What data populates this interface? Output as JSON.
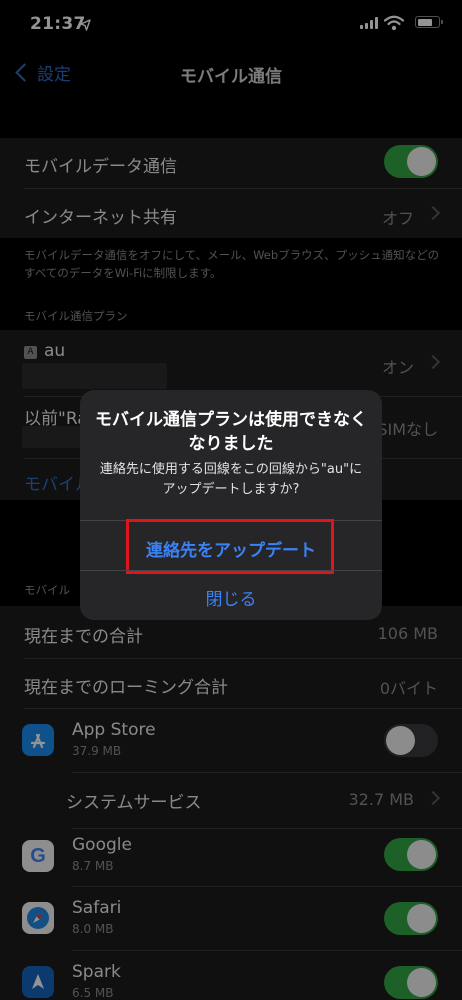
{
  "status_bar": {
    "time": "21:37"
  },
  "nav": {
    "back_label": "設定",
    "title": "モバイル通信"
  },
  "settings": {
    "mobile_data": {
      "label": "モバイルデータ通信",
      "on": true
    },
    "hotspot": {
      "label": "インターネット共有",
      "value": "オフ"
    },
    "footer": "モバイルデータ通信をオフにして、メール、Webブラウズ、プッシュ通知などのすべてのデータをWi-Fiに制限します。",
    "plans_header": "モバイル通信プラン",
    "plan_au": {
      "badge": "A",
      "name": "au",
      "value": "オン"
    },
    "plan_previous": {
      "name": "以前\"Ra",
      "value": "SIMなし"
    },
    "add_plan_partial": "モバイル",
    "usage_header_partial": "モバイル",
    "usage_total": {
      "label": "現在までの合計",
      "value": "106 MB"
    },
    "roaming_total": {
      "label": "現在までのローミング合計",
      "value": "0バイト"
    },
    "system_services": {
      "label": "システムサービス",
      "value": "32.7 MB"
    }
  },
  "apps": [
    {
      "name": "App Store",
      "size": "37.9 MB",
      "on": false
    },
    {
      "name": "Google",
      "size": "8.7 MB",
      "on": true
    },
    {
      "name": "Safari",
      "size": "8.0 MB",
      "on": true
    },
    {
      "name": "Spark",
      "size": "6.5 MB",
      "on": true
    }
  ],
  "alert": {
    "title": "モバイル通信プランは使用できなくなりました",
    "message": "連絡先に使用する回線をこの回線から\"au\"にアップデートしますか?",
    "primary_button": "連絡先をアップデート",
    "close_button": "閉じる"
  },
  "colors": {
    "accent": "#3b82f6",
    "toggle_on": "#34a845",
    "highlight": "#e0141c"
  }
}
